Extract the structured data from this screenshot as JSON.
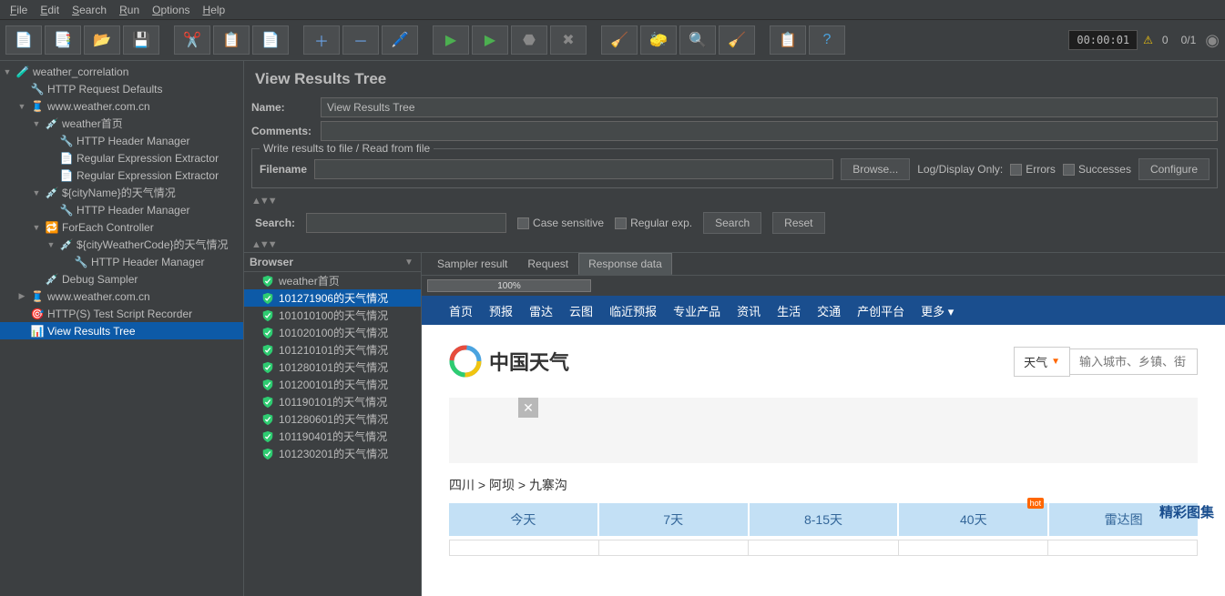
{
  "menubar": {
    "file": "File",
    "edit": "Edit",
    "search": "Search",
    "run": "Run",
    "options": "Options",
    "help": "Help"
  },
  "toolbar": {
    "timer": "00:00:01",
    "warn_count": "0",
    "thread_ratio": "0/1"
  },
  "tree": {
    "n0": "weather_correlation",
    "n1": "HTTP Request Defaults",
    "n2": "www.weather.com.cn",
    "n3": "weather首页",
    "n4": "HTTP Header Manager",
    "n5": "Regular Expression Extractor",
    "n6": "Regular Expression Extractor",
    "n7": "${cityName}的天气情况",
    "n8": "HTTP Header Manager",
    "n9": "ForEach Controller",
    "n10": "${cityWeatherCode}的天气情况",
    "n11": "HTTP Header Manager",
    "n12": "Debug Sampler",
    "n13": "www.weather.com.cn",
    "n14": "HTTP(S) Test Script Recorder",
    "n15": "View Results Tree"
  },
  "panel": {
    "title": "View Results Tree",
    "name_label": "Name:",
    "name_value": "View Results Tree",
    "comments_label": "Comments:",
    "fieldset_legend": "Write results to file / Read from file",
    "filename_label": "Filename",
    "browse": "Browse...",
    "log_display": "Log/Display Only:",
    "errors": "Errors",
    "successes": "Successes",
    "configure": "Configure",
    "search_label": "Search:",
    "case_sensitive": "Case sensitive",
    "regular_exp": "Regular exp.",
    "search_btn": "Search",
    "reset_btn": "Reset",
    "renderer": "Browser",
    "tab_sampler": "Sampler result",
    "tab_request": "Request",
    "tab_response": "Response data",
    "progress": "100%"
  },
  "results": [
    "weather首页",
    "101271906的天气情况",
    "101010100的天气情况",
    "101020100的天气情况",
    "101210101的天气情况",
    "101280101的天气情况",
    "101200101的天气情况",
    "101190101的天气情况",
    "101280601的天气情况",
    "101190401的天气情况",
    "101230201的天气情况"
  ],
  "weather": {
    "nav": [
      "首页",
      "预报",
      "雷达",
      "云图",
      "临近预报",
      "专业产品",
      "资讯",
      "生活",
      "交通",
      "产创平台",
      "更多"
    ],
    "logo_text": "中国天气",
    "search_type": "天气",
    "search_placeholder": "输入城市、乡镇、街",
    "breadcrumb_1": "四川",
    "breadcrumb_2": "阿坝",
    "breadcrumb_3": "九寨沟",
    "forecast_tabs": [
      "今天",
      "7天",
      "8-15天",
      "40天",
      "雷达图"
    ],
    "hot": "hot",
    "gallery": "精彩图集"
  }
}
